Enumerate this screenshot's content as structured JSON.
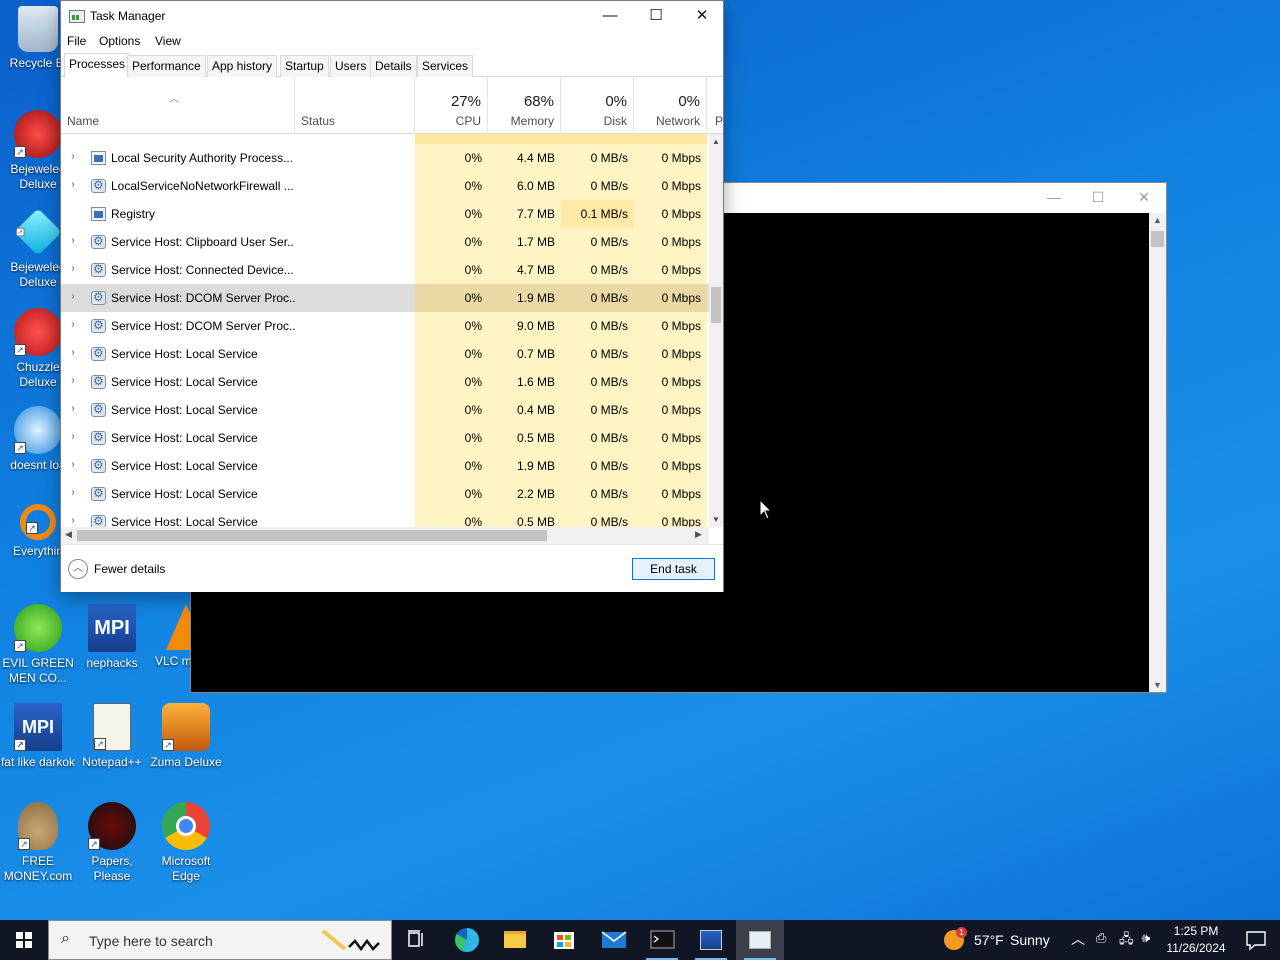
{
  "desktop": {
    "icons": [
      {
        "label": "Recycle Bi"
      },
      {
        "label": "Bejeweled Deluxe"
      },
      {
        "label": "Bejeweled Deluxe"
      },
      {
        "label": "Chuzzle Deluxe"
      },
      {
        "label": "doesnt loa"
      },
      {
        "label": "Everythin"
      },
      {
        "label": "EVIL GREEN MEN CO..."
      },
      {
        "label": "nephacks"
      },
      {
        "label": "VLC m play"
      },
      {
        "label": "fat like darkok"
      },
      {
        "label": "Notepad++"
      },
      {
        "label": "Zuma Deluxe"
      },
      {
        "label": "FREE MONEY.com"
      },
      {
        "label": "Papers, Please"
      },
      {
        "label": "Microsoft Edge"
      }
    ]
  },
  "task_manager": {
    "title": "Task Manager",
    "window_controls": {
      "minimize": "—",
      "maximize": "☐",
      "close": "✕"
    },
    "menu": [
      "File",
      "Options",
      "View"
    ],
    "tabs": [
      "Processes",
      "Performance",
      "App history",
      "Startup",
      "Users",
      "Details",
      "Services"
    ],
    "active_tab": "Processes",
    "columns": {
      "name": "Name",
      "status": "Status",
      "cpu": {
        "pct": "27%",
        "label": "CPU"
      },
      "memory": {
        "pct": "68%",
        "label": "Memory"
      },
      "disk": {
        "pct": "0%",
        "label": "Disk"
      },
      "network": {
        "pct": "0%",
        "label": "Network"
      },
      "extra": "P"
    },
    "rows": [
      {
        "expand": "›",
        "icon": "win",
        "name": "Local Security Authority Process...",
        "cpu": "0%",
        "mem": "4.4 MB",
        "disk": "0 MB/s",
        "net": "0 Mbps"
      },
      {
        "expand": "›",
        "icon": "gear",
        "name": "LocalServiceNoNetworkFirewall ...",
        "cpu": "0%",
        "mem": "6.0 MB",
        "disk": "0 MB/s",
        "net": "0 Mbps"
      },
      {
        "expand": "",
        "icon": "win",
        "name": "Registry",
        "cpu": "0%",
        "mem": "7.7 MB",
        "disk": "0.1 MB/s",
        "net": "0 Mbps"
      },
      {
        "expand": "›",
        "icon": "gear",
        "name": "Service Host: Clipboard User Ser...",
        "cpu": "0%",
        "mem": "1.7 MB",
        "disk": "0 MB/s",
        "net": "0 Mbps"
      },
      {
        "expand": "›",
        "icon": "gear",
        "name": "Service Host: Connected Device...",
        "cpu": "0%",
        "mem": "4.7 MB",
        "disk": "0 MB/s",
        "net": "0 Mbps"
      },
      {
        "expand": "›",
        "icon": "gear",
        "name": "Service Host: DCOM Server Proc...",
        "cpu": "0%",
        "mem": "1.9 MB",
        "disk": "0 MB/s",
        "net": "0 Mbps"
      },
      {
        "expand": "›",
        "icon": "gear",
        "name": "Service Host: DCOM Server Proc...",
        "cpu": "0%",
        "mem": "9.0 MB",
        "disk": "0 MB/s",
        "net": "0 Mbps"
      },
      {
        "expand": "›",
        "icon": "gear",
        "name": "Service Host: Local Service",
        "cpu": "0%",
        "mem": "0.7 MB",
        "disk": "0 MB/s",
        "net": "0 Mbps"
      },
      {
        "expand": "›",
        "icon": "gear",
        "name": "Service Host: Local Service",
        "cpu": "0%",
        "mem": "1.6 MB",
        "disk": "0 MB/s",
        "net": "0 Mbps"
      },
      {
        "expand": "›",
        "icon": "gear",
        "name": "Service Host: Local Service",
        "cpu": "0%",
        "mem": "0.4 MB",
        "disk": "0 MB/s",
        "net": "0 Mbps"
      },
      {
        "expand": "›",
        "icon": "gear",
        "name": "Service Host: Local Service",
        "cpu": "0%",
        "mem": "0.5 MB",
        "disk": "0 MB/s",
        "net": "0 Mbps"
      },
      {
        "expand": "›",
        "icon": "gear",
        "name": "Service Host: Local Service",
        "cpu": "0%",
        "mem": "1.9 MB",
        "disk": "0 MB/s",
        "net": "0 Mbps"
      },
      {
        "expand": "›",
        "icon": "gear",
        "name": "Service Host: Local Service",
        "cpu": "0%",
        "mem": "2.2 MB",
        "disk": "0 MB/s",
        "net": "0 Mbps"
      },
      {
        "expand": "›",
        "icon": "gear",
        "name": "Service Host: Local Service",
        "cpu": "0%",
        "mem": "0.5 MB",
        "disk": "0 MB/s",
        "net": "0 Mbps"
      }
    ],
    "selected_row": 5,
    "footer": {
      "fewer_details": "Fewer details",
      "end_task": "End task"
    }
  },
  "console_window": {
    "controls": {
      "minimize": "—",
      "maximize": "☐",
      "close": "✕"
    }
  },
  "taskbar": {
    "search_placeholder": "Type here to search",
    "weather": {
      "temp": "57°F",
      "condition": "Sunny",
      "badge": "1"
    },
    "time": "1:25 PM",
    "date": "11/26/2024"
  },
  "colors": {
    "desktop": "#1080e0",
    "taskbar": "#101624",
    "cpu_heat": "#fff4c4",
    "selection": "#dcdcdc",
    "accent": "#0078d7"
  }
}
